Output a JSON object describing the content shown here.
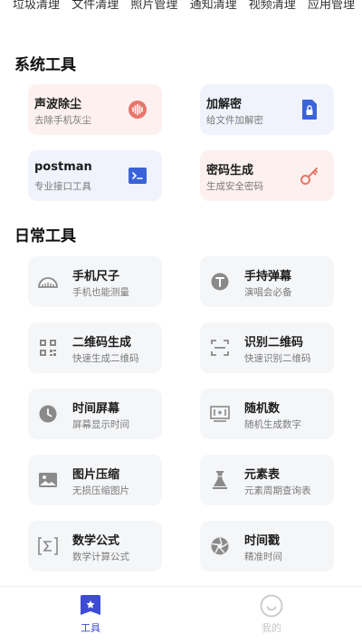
{
  "top_tabs": [
    "垃圾清理",
    "文件清理",
    "照片管理",
    "通知清理",
    "视频清理",
    "应用管理"
  ],
  "sections": {
    "system": {
      "title": "系统工具"
    },
    "daily": {
      "title": "日常工具"
    }
  },
  "system_tools": [
    {
      "title": "声波除尘",
      "sub": "去除手机灰尘",
      "icon": "sound-wave-icon"
    },
    {
      "title": "加解密",
      "sub": "给文件加解密",
      "icon": "file-lock-icon"
    },
    {
      "title": "postman",
      "sub": "专业接口工具",
      "icon": "terminal-icon"
    },
    {
      "title": "密码生成",
      "sub": "生成安全密码",
      "icon": "key-icon"
    }
  ],
  "daily_tools": [
    {
      "title": "手机尺子",
      "sub": "手机也能测量",
      "icon": "ruler-icon"
    },
    {
      "title": "手持弹幕",
      "sub": "演唱会必备",
      "icon": "text-t-icon"
    },
    {
      "title": "二维码生成",
      "sub": "快速生成二维码",
      "icon": "qr-code-icon"
    },
    {
      "title": "识别二维码",
      "sub": "快速识别二维码",
      "icon": "scan-icon"
    },
    {
      "title": "时间屏幕",
      "sub": "屏幕显示时间",
      "icon": "clock-icon"
    },
    {
      "title": "随机数",
      "sub": "随机生成数字",
      "icon": "random-number-icon"
    },
    {
      "title": "图片压缩",
      "sub": "无损压缩图片",
      "icon": "image-icon"
    },
    {
      "title": "元素表",
      "sub": "元素周期查询表",
      "icon": "flask-icon"
    },
    {
      "title": "数学公式",
      "sub": "数学计算公式",
      "icon": "sigma-icon"
    },
    {
      "title": "时间戳",
      "sub": "精准时间",
      "icon": "aperture-icon"
    }
  ],
  "bottom_nav": {
    "tools_label": "工具",
    "mine_label": "我的"
  },
  "colors": {
    "accent": "#3e4bd6",
    "pink_icon": "#e8756a",
    "blue_icon": "#3b63d9",
    "grey_icon": "#8a8a8a"
  }
}
